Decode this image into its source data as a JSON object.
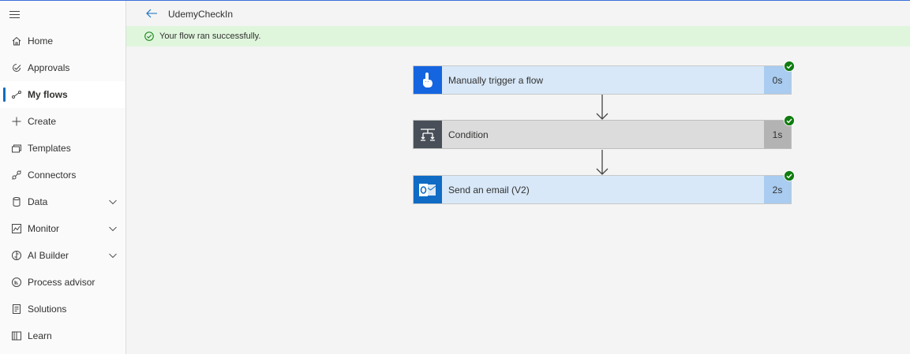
{
  "header": {
    "title": "UdemyCheckIn"
  },
  "banner": {
    "message": "Your flow ran successfully."
  },
  "sidebar": {
    "items": [
      {
        "label": "Home",
        "icon": "home-icon"
      },
      {
        "label": "Approvals",
        "icon": "approvals-icon"
      },
      {
        "label": "My flows",
        "icon": "flows-icon",
        "active": true
      },
      {
        "label": "Create",
        "icon": "plus-icon"
      },
      {
        "label": "Templates",
        "icon": "templates-icon"
      },
      {
        "label": "Connectors",
        "icon": "connectors-icon"
      },
      {
        "label": "Data",
        "icon": "database-icon",
        "expandable": true
      },
      {
        "label": "Monitor",
        "icon": "monitor-icon",
        "expandable": true
      },
      {
        "label": "AI Builder",
        "icon": "brain-icon",
        "expandable": true
      },
      {
        "label": "Process advisor",
        "icon": "process-advisor-icon"
      },
      {
        "label": "Solutions",
        "icon": "solutions-icon"
      },
      {
        "label": "Learn",
        "icon": "book-icon"
      }
    ]
  },
  "steps": [
    {
      "label": "Manually trigger a flow",
      "duration": "0s",
      "status": "succeeded",
      "icon": "touch-icon"
    },
    {
      "label": "Condition",
      "duration": "1s",
      "status": "succeeded",
      "icon": "condition-icon"
    },
    {
      "label": "Send an email (V2)",
      "duration": "2s",
      "status": "succeeded",
      "icon": "outlook-icon"
    }
  ],
  "colors": {
    "accent": "#0f6cbd",
    "success": "#107c10",
    "banner": "#dff6dd",
    "step_blue": "#d8e8f8",
    "condition": "#484f58"
  }
}
